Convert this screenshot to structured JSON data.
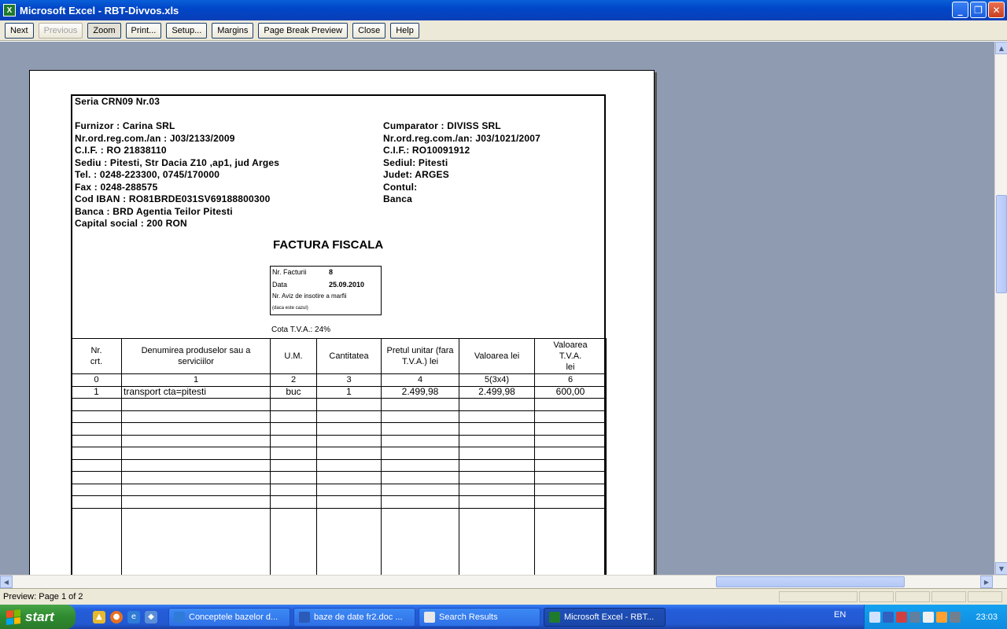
{
  "window": {
    "title": "Microsoft Excel - RBT-Divvos.xls",
    "icon_letter": "X",
    "controls": {
      "minimize": "_",
      "restore": "❐",
      "close": "✕"
    }
  },
  "toolbar": {
    "next": "Next",
    "previous": "Previous",
    "zoom": "Zoom",
    "print": "Print...",
    "setup": "Setup...",
    "margins": "Margins",
    "page_break_preview": "Page Break Preview",
    "close": "Close",
    "help": "Help"
  },
  "invoice": {
    "seria": "Seria  CRN09  Nr.03",
    "furnizor": [
      "Furnizor : Carina SRL",
      "Nr.ord.reg.com./an : J03/2133/2009",
      "C.I.F. : RO 21838110",
      "Sediu : Pitesti, Str Dacia Z10 ,ap1, jud Arges",
      "Tel. : 0248-223300, 0745/170000",
      "Fax : 0248-288575",
      "Cod IBAN : RO81BRDE031SV69188800300",
      "Banca : BRD Agentia Teilor Pitesti",
      "Capital social : 200 RON"
    ],
    "cumparator": [
      "Cumparator : DIVISS SRL",
      "Nr.ord.reg.com./an: J03/1021/2007",
      "C.I.F.: RO10091912",
      "Sediul: Pitesti",
      "Judet: ARGES",
      "Contul:",
      "Banca"
    ],
    "title": "FACTURA FISCALA",
    "box": {
      "nr_label": "Nr. Facturii",
      "nr_value": "8",
      "data_label": "Data",
      "data_value": "25.09.2010",
      "aviz": "Nr. Aviz de insotire a marfii",
      "daca": "(daca este cazul)"
    },
    "cota": "Cota T.V.A.: 24%",
    "headers": [
      "Nr.\ncrt.",
      "Denumirea produselor sau a serviciilor",
      "U.M.",
      "Cantitatea",
      "Pretul unitar (fara T.V.A.) lei",
      "Valoarea lei",
      "Valoarea T.V.A.\nlei"
    ],
    "index_row": [
      "0",
      "1",
      "2",
      "3",
      "4",
      "5(3x4)",
      "6"
    ],
    "rows": [
      [
        "1",
        "transport cta=pitesti",
        "buc",
        "1",
        "2.499,98",
        "2.499,98",
        "600,00"
      ]
    ]
  },
  "status": {
    "text": "Preview: Page 1 of 2"
  },
  "taskbar": {
    "start": "start",
    "tasks": [
      "Conceptele bazelor d...",
      "baze de date fr2.doc ...",
      "Search Results",
      "Microsoft Excel - RBT..."
    ],
    "language": "EN",
    "clock": "23:03"
  }
}
